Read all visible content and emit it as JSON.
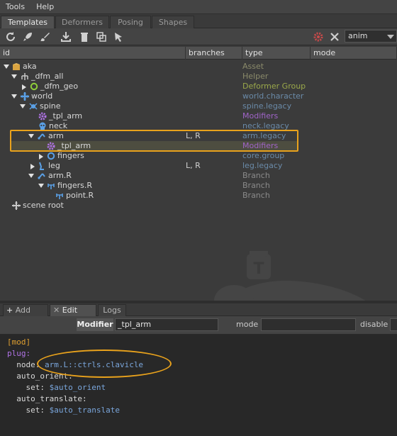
{
  "menu": {
    "items": [
      "Tools",
      "Help"
    ]
  },
  "tabs": [
    {
      "label": "Templates",
      "active": true
    },
    {
      "label": "Deformers",
      "active": false
    },
    {
      "label": "Posing",
      "active": false
    },
    {
      "label": "Shapes",
      "active": false
    }
  ],
  "toolbar": {
    "icons": [
      "refresh-icon",
      "rocket-icon",
      "brush-icon",
      "import-icon",
      "trash-icon",
      "copy-icon",
      "pointer-icon",
      "gear-icon",
      "tools-icon"
    ],
    "combo_value": "anim"
  },
  "columns": [
    "id",
    "branches",
    "type",
    "mode"
  ],
  "tree": [
    {
      "name": "aka",
      "type": "Asset",
      "branches": "",
      "type_color": "#8a8a6a"
    },
    {
      "name": "_dfm_all",
      "type": "Helper",
      "branches": "",
      "type_color": "#8a8a6a"
    },
    {
      "name": "_dfm_geo",
      "type": "Deformer Group",
      "branches": "",
      "type_color": "#9aa84a"
    },
    {
      "name": "world",
      "type": "world.character",
      "branches": "",
      "type_color": "#6a8aa8"
    },
    {
      "name": "spine",
      "type": "spine.legacy",
      "branches": "",
      "type_color": "#6a8aa8"
    },
    {
      "name": "_tpl_arm",
      "type": "Modifiers",
      "branches": "",
      "type_color": "#a064c8"
    },
    {
      "name": "neck",
      "type": "neck.legacy",
      "branches": "",
      "type_color": "#6a8aa8"
    },
    {
      "name": "arm",
      "type": "arm.legacy",
      "branches": "L, R",
      "type_color": "#6a8aa8"
    },
    {
      "name": "_tpl_arm",
      "type": "Modifiers",
      "branches": "",
      "type_color": "#a064c8"
    },
    {
      "name": "fingers",
      "type": "core.group",
      "branches": "",
      "type_color": "#6a8aa8"
    },
    {
      "name": "leg",
      "type": "leg.legacy",
      "branches": "L, R",
      "type_color": "#6a8aa8"
    },
    {
      "name": "arm.R",
      "type": "Branch",
      "branches": "",
      "type_color": "#8a8a8a"
    },
    {
      "name": "fingers.R",
      "type": "Branch",
      "branches": "",
      "type_color": "#8a8a8a"
    },
    {
      "name": "point.R",
      "type": "Branch",
      "branches": "",
      "type_color": "#8a8a8a"
    },
    {
      "name": "scene root",
      "type": "",
      "branches": "",
      "type_color": "#8a8a8a"
    }
  ],
  "bottom_tabs": [
    {
      "label": "Add",
      "active": false
    },
    {
      "label": "Edit",
      "active": true
    },
    {
      "label": "Logs",
      "active": false
    }
  ],
  "modifier": {
    "label": "Modifier",
    "value": "_tpl_arm",
    "mode_label": "mode",
    "mode_value": "",
    "disable_label": "disable"
  },
  "code": {
    "l1": "[mod]",
    "l2": "plug:",
    "l3a": "  node: ",
    "l3b": "arm.L::ctrls.clavicle",
    "l4": "  auto_orient:",
    "l5a": "    set: ",
    "l5b": "$auto_orient",
    "l6": "  auto_translate:",
    "l7a": "    set: ",
    "l7b": "$auto_translate"
  },
  "colors": {
    "accent": "#e9a21c",
    "code_key": "#d8d8d8",
    "code_value": "#7aa6dc",
    "code_tag": "#e0a030"
  }
}
